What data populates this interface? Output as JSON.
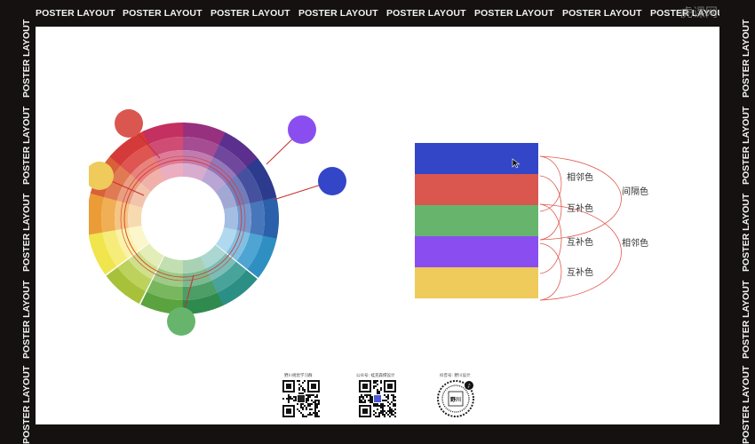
{
  "frame": {
    "text": "POSTER LAYOUT",
    "top_count": 8,
    "side_count": 5
  },
  "watermark": "虎课网",
  "palette": {
    "bars": [
      {
        "name": "blue",
        "color": "#3346c8"
      },
      {
        "name": "red",
        "color": "#d9574f"
      },
      {
        "name": "green",
        "color": "#67b56d"
      },
      {
        "name": "purple",
        "color": "#8a4ef0"
      },
      {
        "name": "yellow",
        "color": "#eecb5a"
      }
    ],
    "labels": {
      "adjacent_1": "相邻色",
      "complement_1": "互补色",
      "complement_2": "互补色",
      "complement_3": "互补色",
      "interval": "间隔色",
      "adjacent_2": "相邻色"
    }
  },
  "wheel": {
    "markers": [
      {
        "name": "red",
        "color": "#d9574f"
      },
      {
        "name": "purple",
        "color": "#8a4ef0"
      },
      {
        "name": "blue",
        "color": "#3346c8"
      },
      {
        "name": "yellow",
        "color": "#eecb5a"
      },
      {
        "name": "green",
        "color": "#67b56d"
      }
    ]
  },
  "footer": {
    "qr1_caption": "野川视觉学习群",
    "qr2_caption": "公众号: 蛙克森撰设计",
    "qr3_caption": "抖音号: 野川设计",
    "seal_text": "野川"
  }
}
